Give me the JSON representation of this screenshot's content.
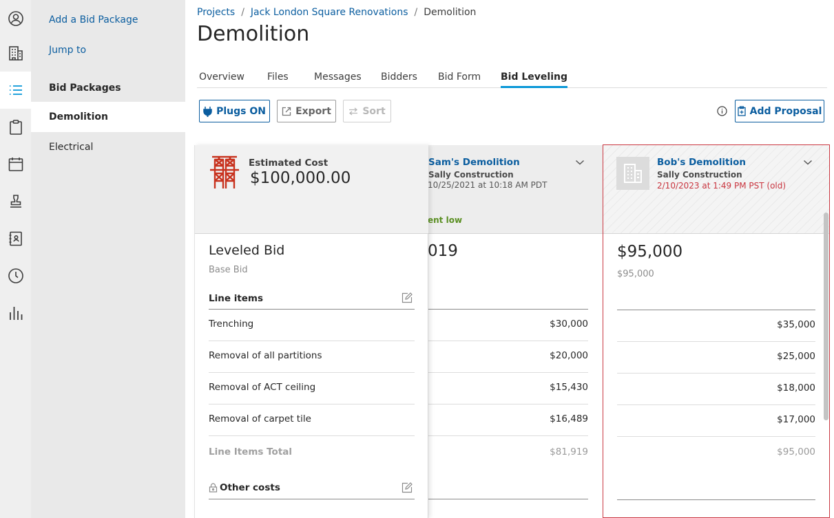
{
  "rail": {
    "icons": [
      "user-icon",
      "building-icon",
      "list-icon",
      "clipboard-icon",
      "calendar-icon",
      "stamp-icon",
      "address-book-icon",
      "clock-icon",
      "bar-chart-icon"
    ]
  },
  "subnav": {
    "add_bid_package": "Add a Bid Package",
    "jump_to": "Jump to",
    "bid_packages_heading": "Bid Packages",
    "items": [
      {
        "label": "Demolition",
        "active": true
      },
      {
        "label": "Electrical",
        "active": false
      }
    ]
  },
  "breadcrumb": {
    "projects": "Projects",
    "project": "Jack London Square Renovations",
    "current": "Demolition",
    "separator": "/"
  },
  "page_title": "Demolition",
  "tabs": [
    {
      "label": "Overview"
    },
    {
      "label": "Files"
    },
    {
      "label": "Messages"
    },
    {
      "label": "Bidders"
    },
    {
      "label": "Bid Form"
    },
    {
      "label": "Bid Leveling",
      "active": true
    }
  ],
  "toolbar": {
    "plugs_label": "Plugs ON",
    "export_label": "Export",
    "sort_label": "Sort",
    "add_proposal_label": "Add Proposal"
  },
  "estimate": {
    "label": "Estimated Cost",
    "value": "$100,000.00"
  },
  "leveled": {
    "title": "Leveled Bid",
    "subtitle": "Base Bid",
    "line_items_heading": "Line items",
    "line_items": [
      "Trenching",
      "Removal of all partitions",
      "Removal of ACT ceiling",
      "Removal of carpet tile"
    ],
    "total_label": "Line Items Total",
    "other_costs_heading": "Other costs"
  },
  "bidders": [
    {
      "name": "Sam's Demolition",
      "company": "Sally Construction",
      "date": "10/25/2021 at 10:18 AM PDT",
      "tag": "ent low",
      "total": "019",
      "values": [
        "$30,000",
        "$20,000",
        "$15,430",
        "$16,489"
      ],
      "line_total": "$81,919"
    },
    {
      "name": "Bob's Demolition",
      "company": "Sally Construction",
      "date": "2/10/2023 at 1:49 PM PST (old)",
      "total": "$95,000",
      "sub_total": "$95,000",
      "values": [
        "$35,000",
        "$25,000",
        "$18,000",
        "$17,000"
      ],
      "line_total": "$95,000"
    }
  ],
  "colors": {
    "link": "#0a5d9f",
    "accent": "#0696d7",
    "outdated": "#c9353f",
    "low_bid": "#5a8f22"
  }
}
